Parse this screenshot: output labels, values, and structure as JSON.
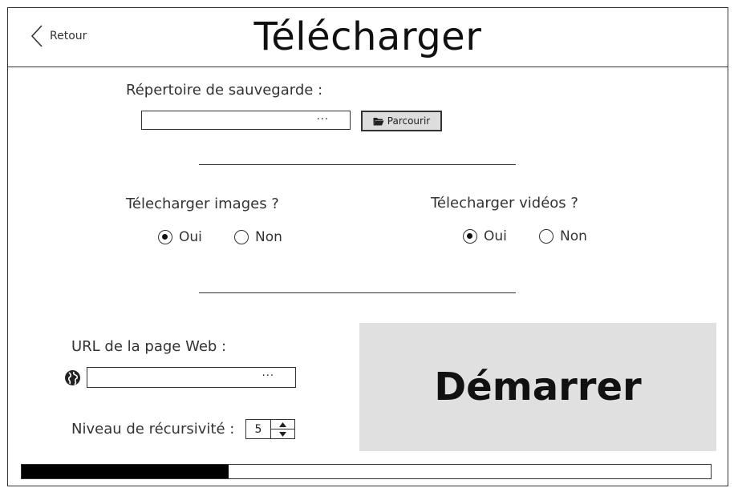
{
  "header": {
    "back_label": "Retour",
    "title": "Télécharger"
  },
  "save_dir": {
    "label": "Répertoire de sauvegarde :",
    "value": "",
    "ellipsis": "···",
    "browse_label": "Parcourir"
  },
  "images": {
    "label": "Télecharger images ?",
    "options": [
      {
        "label": "Oui",
        "checked": true
      },
      {
        "label": "Non",
        "checked": false
      }
    ]
  },
  "videos": {
    "label": "Télecharger vidéos ?",
    "options": [
      {
        "label": "Oui",
        "checked": true
      },
      {
        "label": "Non",
        "checked": false
      }
    ]
  },
  "url": {
    "label": "URL de la page Web  :",
    "value": "",
    "ellipsis": "···",
    "icon": "globe-icon"
  },
  "recursion": {
    "label": "Niveau de récursivité :",
    "value": "5"
  },
  "start_button": {
    "label": "Démarrer"
  },
  "progress": {
    "fraction": 0.3
  },
  "colors": {
    "start_bg": "#e0e0e0",
    "progress_fill": "#000000"
  }
}
